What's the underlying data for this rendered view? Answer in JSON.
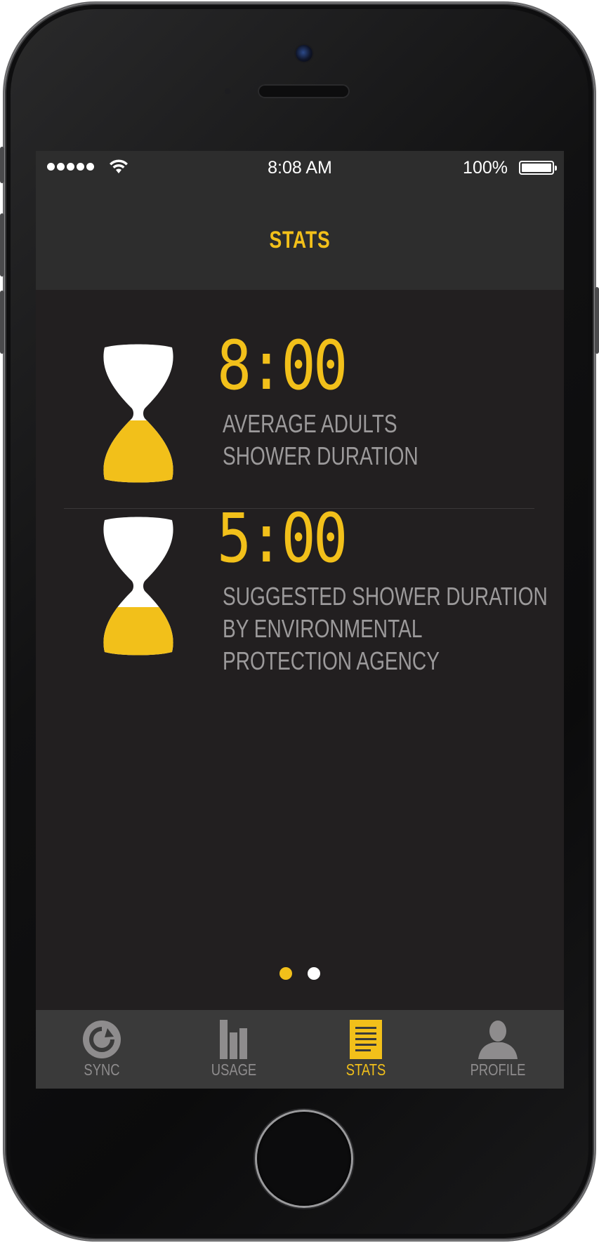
{
  "status_bar": {
    "time": "8:08 AM",
    "battery_percent": "100%"
  },
  "header": {
    "title": "STATS"
  },
  "stats": [
    {
      "value": "8:00",
      "description_lines": [
        "AVERAGE ADULTS",
        "SHOWER DURATION"
      ],
      "hourglass_fill": 0.45
    },
    {
      "value": "5:00",
      "description_lines": [
        "SUGGESTED SHOWER DURATION",
        "BY ENVIRONMENTAL",
        "PROTECTION AGENCY"
      ],
      "hourglass_fill": 0.35
    }
  ],
  "pagination": {
    "current_page": 1,
    "total_pages": 2
  },
  "tab_bar": {
    "tabs": [
      {
        "label": "SYNC",
        "icon": "sync-icon",
        "active": false
      },
      {
        "label": "USAGE",
        "icon": "bar-chart-icon",
        "active": false
      },
      {
        "label": "STATS",
        "icon": "document-icon",
        "active": true
      },
      {
        "label": "PROFILE",
        "icon": "user-icon",
        "active": false
      }
    ]
  },
  "colors": {
    "accent": "#f2c01a",
    "background": "#221f20",
    "bar": "#2d2d2d",
    "tab_bar": "#3a3a3a",
    "inactive": "#8e8c8d",
    "text_muted": "#9c9a9b"
  }
}
